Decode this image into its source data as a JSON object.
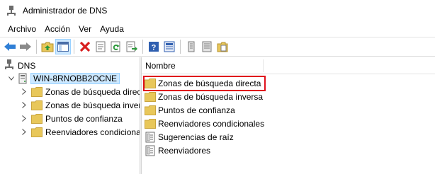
{
  "window": {
    "title": "Administrador de DNS"
  },
  "menu": [
    {
      "label": "Archivo"
    },
    {
      "label": "Acción"
    },
    {
      "label": "Ver"
    },
    {
      "label": "Ayuda"
    }
  ],
  "toolbar": {
    "buttons": [
      {
        "icon": "back-arrow-icon"
      },
      {
        "icon": "forward-arrow-icon"
      },
      {
        "icon": "up-folder-icon"
      },
      {
        "icon": "show-hide-console-tree-icon",
        "pressed": true
      },
      {
        "icon": "delete-icon"
      },
      {
        "icon": "properties-icon"
      },
      {
        "icon": "refresh-icon"
      },
      {
        "icon": "export-list-icon"
      },
      {
        "icon": "help-icon"
      },
      {
        "icon": "help-page-icon"
      },
      {
        "icon": "server-list-icon"
      },
      {
        "icon": "record-list-icon"
      },
      {
        "icon": "folder-docs-icon"
      }
    ]
  },
  "tree": {
    "root": {
      "label": "DNS"
    },
    "server": {
      "label": "WIN-8RNOBB2OCNE"
    },
    "children": [
      {
        "label": "Zonas de búsqueda directa"
      },
      {
        "label": "Zonas de búsqueda inversa"
      },
      {
        "label": "Puntos de confianza"
      },
      {
        "label": "Reenviadores condicionales"
      }
    ]
  },
  "list": {
    "column": "Nombre",
    "items": [
      {
        "label": "Zonas de búsqueda directa",
        "icon": "folder-icon",
        "highlighted": true
      },
      {
        "label": "Zonas de búsqueda inversa",
        "icon": "folder-icon"
      },
      {
        "label": "Puntos de confianza",
        "icon": "folder-icon"
      },
      {
        "label": "Reenviadores condicionales",
        "icon": "folder-icon"
      },
      {
        "label": "Sugerencias de raíz",
        "icon": "server-doc-icon"
      },
      {
        "label": "Reenviadores",
        "icon": "server-doc-icon"
      }
    ]
  },
  "colors": {
    "folder": "#e8c75a",
    "selection": "#cce8ff",
    "highlight": "#e0101c"
  }
}
